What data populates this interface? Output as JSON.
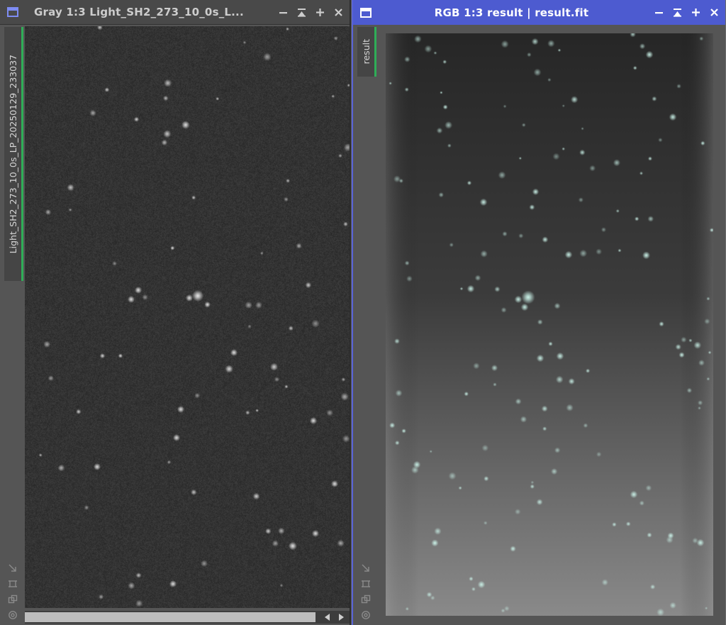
{
  "windows": [
    {
      "id": "left",
      "title": "Gray 1:3 Light_SH2_273_10_0s_L...",
      "tab_label": "Light_SH2_273_10_0s_LP_20250129_233037",
      "accent": "#2fae57"
    },
    {
      "id": "right",
      "title": "RGB 1:3 result | result.fit",
      "tab_label": "result",
      "accent": "#4d5bd0"
    }
  ],
  "controls": {
    "minimize_icon": "minimize-icon",
    "shade_icon": "shade-icon",
    "maximize_icon": "maximize-icon",
    "close_icon": "close-icon"
  },
  "side_icons": [
    "fit-to-window-icon",
    "zoom-frame-icon",
    "clone-view-icon",
    "settings-icon"
  ],
  "colors": {
    "titlebar_active": "#4d5bd0",
    "titlebar_inactive": "#494949",
    "star_tint_right": "#bfeee3",
    "sky_left": "#333333",
    "sky_right_top": "#272727",
    "sky_right_bottom": "#8a8a8a"
  }
}
